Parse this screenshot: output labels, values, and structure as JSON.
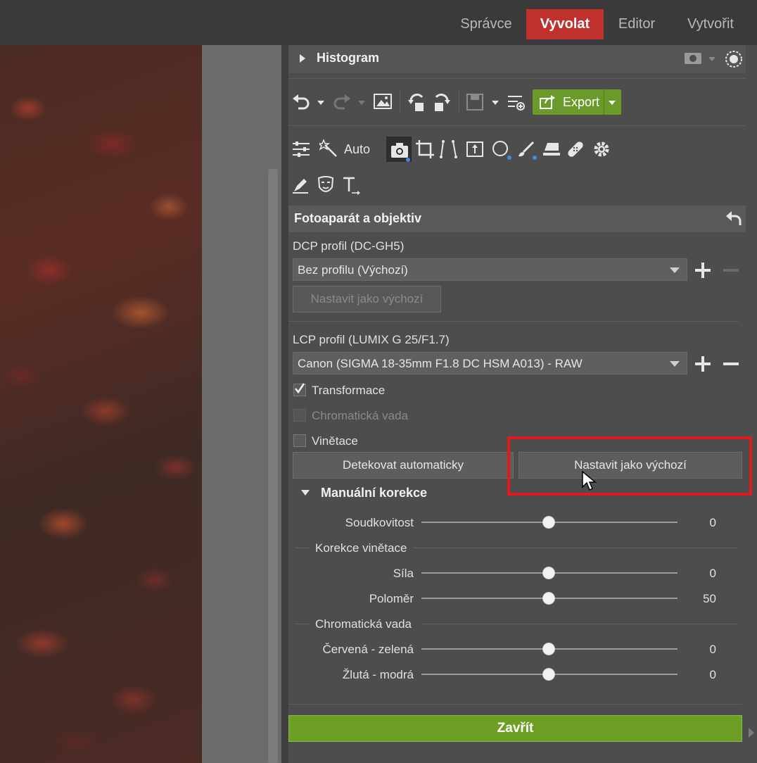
{
  "top_nav": {
    "tabs": [
      {
        "label": "Správce",
        "active": false
      },
      {
        "label": "Vyvolat",
        "active": true
      },
      {
        "label": "Editor",
        "active": false
      },
      {
        "label": "Vytvořit",
        "active": false
      }
    ]
  },
  "histogram": {
    "title": "Histogram"
  },
  "toolbar": {
    "export_label": "Export"
  },
  "tools": {
    "auto_label": "Auto"
  },
  "section": {
    "title": "Fotoaparát a objektiv",
    "dcp": {
      "label": "DCP profil (DC-GH5)",
      "selected": "Bez profilu (Výchozí)",
      "set_default": "Nastavit jako výchozí"
    },
    "lcp": {
      "label": "LCP profil (LUMIX G 25/F1.7)",
      "selected": "Canon (SIGMA 18-35mm F1.8 DC HSM A013) - RAW",
      "transform": {
        "label": "Transformace",
        "checked": true
      },
      "chromatic": {
        "label": "Chromatická vada",
        "checked": false,
        "disabled": true
      },
      "vignette": {
        "label": "Vinětace",
        "checked": false
      },
      "detect_button": "Detekovat automaticky",
      "set_default_button": "Nastavit jako výchozí"
    },
    "manual": {
      "title": "Manuální korekce",
      "distortion": {
        "label": "Soudkovitost",
        "value": 0
      },
      "vignette_group": "Korekce vinětace",
      "strength": {
        "label": "Síla",
        "value": 0
      },
      "radius": {
        "label": "Poloměr",
        "value": 50
      },
      "chromatic_group": "Chromatická vada",
      "red_green": {
        "label": "Červená - zelená",
        "value": 0
      },
      "yellow_blue": {
        "label": "Žlutá - modrá",
        "value": 0
      }
    }
  },
  "close_label": "Zavřít",
  "colors": {
    "accent_red": "#c0312d",
    "accent_green": "#6c9f24",
    "highlight": "#e11b1b"
  }
}
